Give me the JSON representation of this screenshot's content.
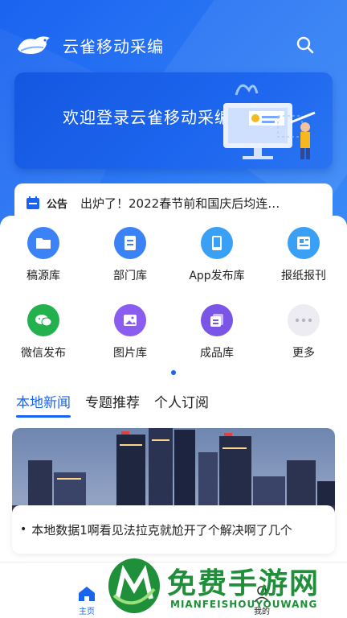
{
  "header": {
    "title": "云雀移动采编"
  },
  "banner": {
    "text": "欢迎登录云雀移动采编"
  },
  "notice": {
    "tag": "公告",
    "text": "出炉了！2022春节前和国庆后均连…"
  },
  "grid": {
    "items": [
      {
        "label": "稿源库",
        "icon": "folder-icon",
        "color": "#3b82f6"
      },
      {
        "label": "部门库",
        "icon": "document-icon",
        "color": "#3b82f6"
      },
      {
        "label": "App发布库",
        "icon": "phone-icon",
        "color": "#3aa0f5"
      },
      {
        "label": "报纸报刊",
        "icon": "newspaper-icon",
        "color": "#3aa0f5"
      },
      {
        "label": "微信发布",
        "icon": "wechat-icon",
        "color": "#22b14c"
      },
      {
        "label": "图片库",
        "icon": "image-icon",
        "color": "#8a5cf0"
      },
      {
        "label": "成品库",
        "icon": "files-icon",
        "color": "#7a55e6"
      },
      {
        "label": "更多",
        "icon": "more-icon",
        "color": "#e8e8ee"
      }
    ]
  },
  "tabs": [
    {
      "label": "本地新闻",
      "active": true
    },
    {
      "label": "专题推荐",
      "active": false
    },
    {
      "label": "个人订阅",
      "active": false
    }
  ],
  "news": {
    "bullet": "•",
    "title": "本地数据1啊看见法拉克就尬开了个解决啊了几个"
  },
  "nav": {
    "home": "主页",
    "mine": "我的"
  },
  "watermark": {
    "title": "免费手游网",
    "subtitle": "MIANFEISHOUYOUWANG"
  },
  "colors": {
    "primary": "#1a63f0",
    "watermark": "#1f8f3a"
  }
}
